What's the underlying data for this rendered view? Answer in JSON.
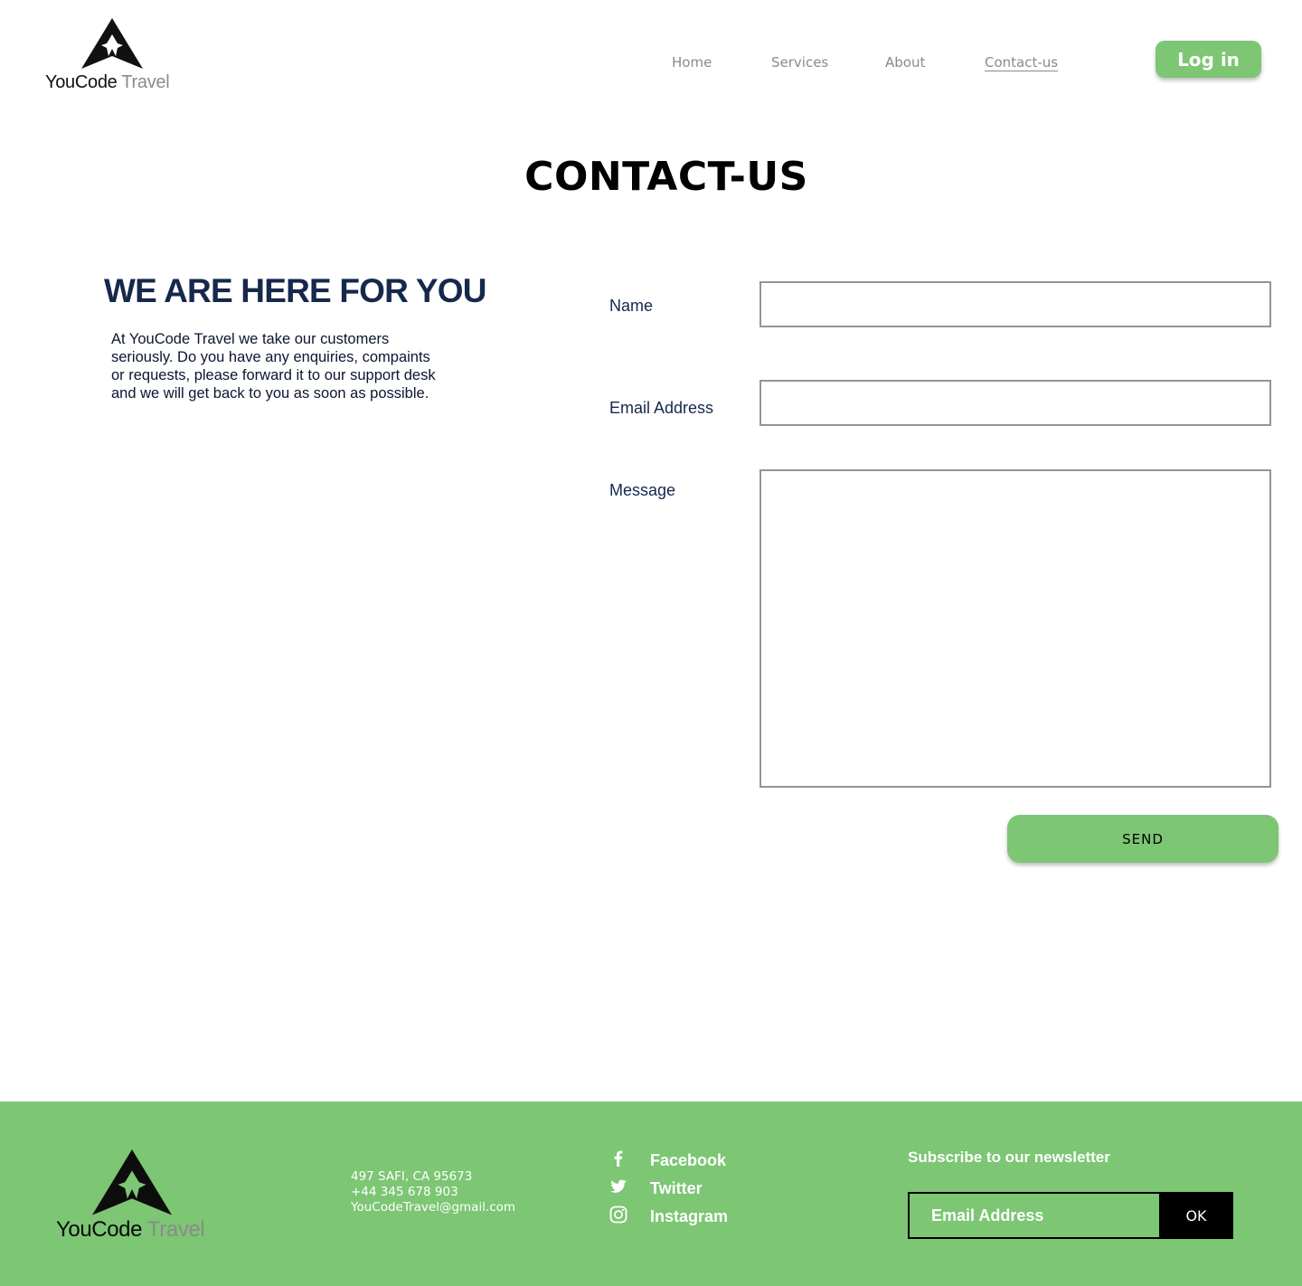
{
  "header": {
    "logo": {
      "name_primary": "YouCode",
      "name_secondary": "Travel"
    },
    "nav": [
      {
        "label": "Home"
      },
      {
        "label": "Services"
      },
      {
        "label": "About"
      },
      {
        "label": "Contact-us",
        "active": true
      }
    ],
    "login_label": "Log in"
  },
  "page": {
    "title": "CONTACT-US"
  },
  "intro": {
    "heading": "WE ARE HERE FOR YOU",
    "text": "At YouCode Travel we take our customers seriously. Do you have any enquiries, compaints or requests, please forward it to our support desk and we will get back to you as soon as possible."
  },
  "form": {
    "name_label": "Name",
    "name_value": "",
    "email_label": "Email Address",
    "email_value": "",
    "message_label": "Message",
    "message_value": "",
    "send_label": "SEND"
  },
  "footer": {
    "logo": {
      "name_primary": "YouCode",
      "name_secondary": "Travel"
    },
    "contact": {
      "address": "497  SAFI, CA 95673",
      "phone": "+44 345 678 903",
      "email": "YouCodeTravel@gmail.com"
    },
    "social": [
      {
        "label": "Facebook",
        "icon": "facebook-icon"
      },
      {
        "label": "Twitter",
        "icon": "twitter-icon"
      },
      {
        "label": "Instagram",
        "icon": "instagram-icon"
      }
    ],
    "newsletter": {
      "title": "Subscribe to our newsletter",
      "placeholder": "Email Address",
      "button_label": "OK"
    }
  },
  "colors": {
    "accent_green": "#7cc674",
    "heading_navy": "#16284c",
    "nav_gray": "#8a8a8a",
    "field_border": "#8e969d"
  }
}
